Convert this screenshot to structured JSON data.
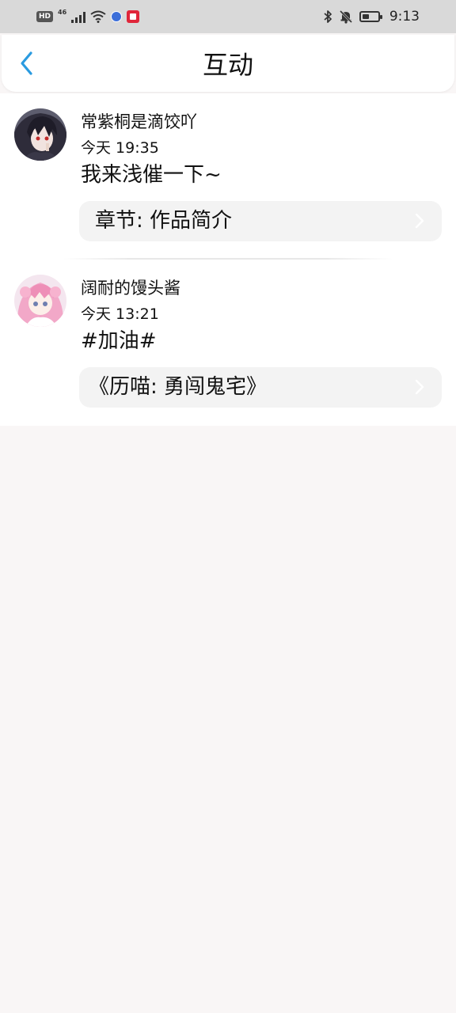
{
  "status_bar": {
    "hd": "HD",
    "network": "46",
    "time": "9:13",
    "battery_level": 0.45
  },
  "header": {
    "title": "互动"
  },
  "items": [
    {
      "username": "常紫桐是滴饺吖",
      "time": "今天 19:35",
      "comment": "我来浅催一下~",
      "link": "章节: 作品简介"
    },
    {
      "username": "阔耐的馒头酱",
      "time": "今天 13:21",
      "comment": "#加油#",
      "link": "《历喵: 勇闯鬼宅》"
    }
  ],
  "colors": {
    "accent": "#2a9be0",
    "page_bg": "#f9f6f6",
    "card_bg": "#f3f3f3",
    "status_bar_bg": "#d9d9d9"
  }
}
